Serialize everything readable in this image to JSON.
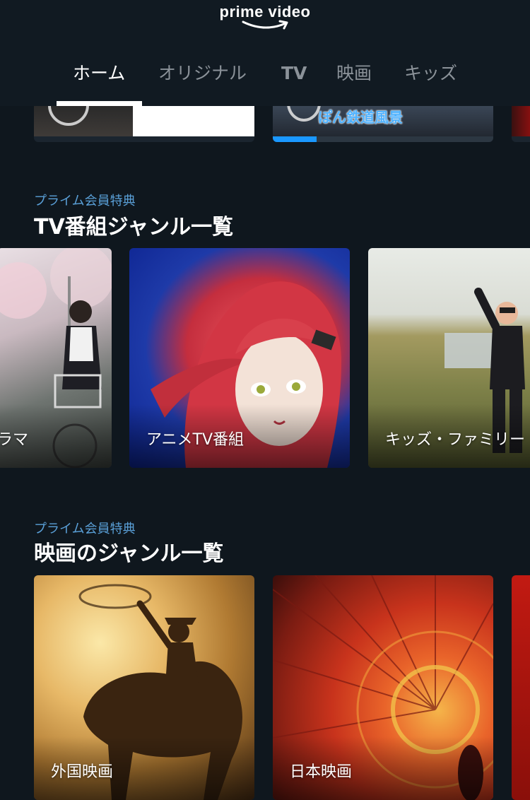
{
  "header": {
    "logo_text": "prime video",
    "tabs": [
      {
        "label": "ホーム",
        "active": true
      },
      {
        "label": "オリジナル",
        "active": false
      },
      {
        "label": "TV",
        "active": false
      },
      {
        "label": "映画",
        "active": false
      },
      {
        "label": "キッズ",
        "active": false
      }
    ]
  },
  "continue_watching": {
    "items": [
      {
        "title_text": ""
      },
      {
        "title_text": "ぽん鉄道風景",
        "progress": 0.2
      },
      {
        "title_text": ""
      }
    ]
  },
  "tv_genres": {
    "kicker": "プライム会員特典",
    "title": "TV番組ジャンル一覧",
    "cards": [
      {
        "label": "ラマ"
      },
      {
        "label": "アニメTV番組"
      },
      {
        "label": "キッズ・ファミリー"
      }
    ]
  },
  "movie_genres": {
    "kicker": "プライム会員特典",
    "title": "映画のジャンル一覧",
    "cards": [
      {
        "label": "外国映画"
      },
      {
        "label": "日本映画"
      },
      {
        "label": ""
      }
    ]
  },
  "colors": {
    "background": "#0f171e",
    "accent_blue": "#1a98ff",
    "kicker_blue": "#5aa0d8"
  }
}
